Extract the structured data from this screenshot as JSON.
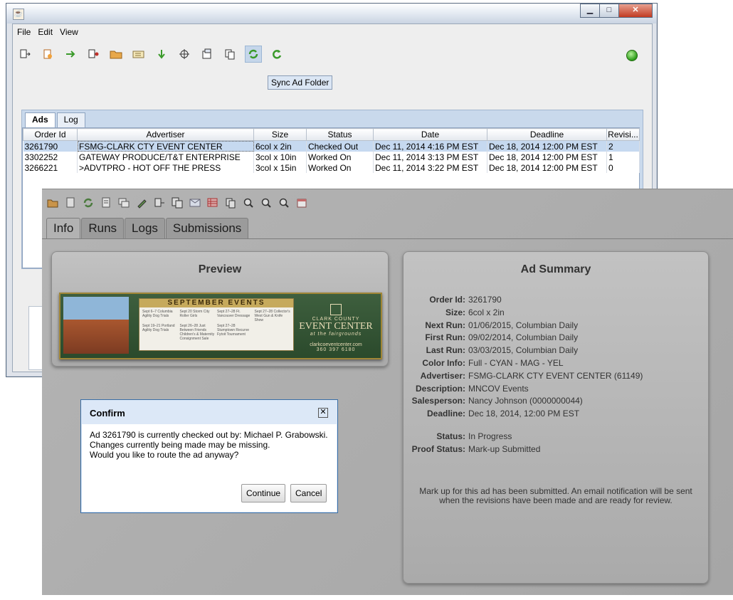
{
  "back_window": {
    "menu": [
      "File",
      "Edit",
      "View"
    ],
    "tooltip": "Sync Ad Folder",
    "tabs": [
      "Ads",
      "Log"
    ],
    "table": {
      "columns": [
        "Order Id",
        "Advertiser",
        "Size",
        "Status",
        "Date",
        "Deadline",
        "Revisi..."
      ],
      "rows": [
        [
          "3261790",
          "FSMG-CLARK CTY EVENT CENTER",
          "6col x 2in",
          "Checked Out",
          "Dec 11, 2014 4:16 PM EST",
          "Dec 18, 2014 12:00 PM EST",
          "2"
        ],
        [
          "3302252",
          "GATEWAY PRODUCE/T&T ENTERPRISE",
          "3col x 10in",
          "Worked On",
          "Dec 11, 2014 3:13 PM EST",
          "Dec 18, 2014 12:00 PM EST",
          "1"
        ],
        [
          "3266221",
          ">ADVTPRO - HOT OFF THE PRESS",
          "3col x 15in",
          "Worked On",
          "Dec 11, 2014 3:22 PM EST",
          "Dec 18, 2014 12:00 PM EST",
          "0"
        ]
      ]
    }
  },
  "front_window": {
    "tabs": [
      "Info",
      "Runs",
      "Logs",
      "Submissions"
    ],
    "preview": {
      "title": "Preview",
      "ad": {
        "header": "SEPTEMBER EVENTS",
        "events": [
          "Sept 6–7 Columbia Agility Dog Trials",
          "Sept 20 Storm City Roller Girls",
          "Sept 27–28 Ft. Vancouver Dressage",
          "Sept 27–28 Collector's West Gun & Knife Show",
          "Sept 19–21 Portland Agility Dog Trials",
          "Sept 26–28 Just Between Friends Children's & Maternity Consignment Sale",
          "Sept 27–28 Stumptown Recurve Fytoit Tournament"
        ],
        "logo_top": "CLARK COUNTY",
        "logo_main": "EVENT CENTER",
        "logo_sub": "at the fairgrounds",
        "logo_url": "clarkcoeventcenter.com",
        "logo_phone": "360 397 6180"
      }
    },
    "summary": {
      "title": "Ad Summary",
      "rows": [
        {
          "label": "Order Id:",
          "value": "3261790"
        },
        {
          "label": "Size:",
          "value": "6col x 2in"
        },
        {
          "label": "Next Run:",
          "value": "01/06/2015, Columbian Daily"
        },
        {
          "label": "First Run:",
          "value": "09/02/2014, Columbian Daily"
        },
        {
          "label": "Last Run:",
          "value": "03/03/2015, Columbian Daily"
        },
        {
          "label": "Color Info:",
          "value": "Full - CYAN - MAG - YEL"
        },
        {
          "label": "Advertiser:",
          "value": "FSMG-CLARK CTY EVENT CENTER (61149)"
        },
        {
          "label": "Description:",
          "value": "MNCOV Events"
        },
        {
          "label": "Salesperson:",
          "value": "Nancy Johnson (0000000044)"
        },
        {
          "label": "Deadline:",
          "value": "Dec 18, 2014, 12:00 PM EST"
        },
        {
          "label": "Status:",
          "value": "In Progress"
        },
        {
          "label": "Proof Status:",
          "value": "Mark-up Submitted"
        }
      ],
      "note": "Mark up for this ad has been submitted. An email notification will be sent when the revisions have been made and are ready for review."
    }
  },
  "dialog": {
    "title": "Confirm",
    "lines": [
      "Ad 3261790 is currently checked out by: Michael P. Grabowski.",
      "Changes currently being made may be missing.",
      "Would you like to route the ad anyway?"
    ],
    "continue_label": "Continue",
    "cancel_label": "Cancel"
  },
  "colors": {
    "selection": "#c6d9f0",
    "status_ok": "#2b9b18",
    "dialog_border": "#3a6ea5"
  }
}
